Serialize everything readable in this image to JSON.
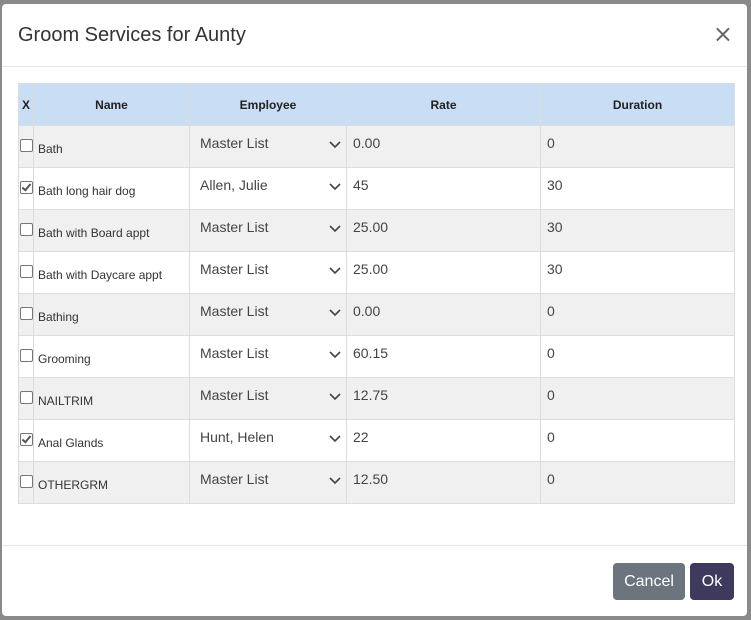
{
  "dialog": {
    "title": "Groom Services for Aunty",
    "close_glyph": "×"
  },
  "table": {
    "headers": {
      "x": "X",
      "name": "Name",
      "employee": "Employee",
      "rate": "Rate",
      "duration": "Duration"
    },
    "rows": [
      {
        "checked": false,
        "name": "Bath",
        "employee": "Master List",
        "rate": "0.00",
        "duration": "0"
      },
      {
        "checked": true,
        "name": "Bath long hair dog",
        "employee": "Allen, Julie",
        "rate": "45",
        "duration": "30"
      },
      {
        "checked": false,
        "name": "Bath with Board appt",
        "employee": "Master List",
        "rate": "25.00",
        "duration": "30"
      },
      {
        "checked": false,
        "name": "Bath with Daycare appt",
        "employee": "Master List",
        "rate": "25.00",
        "duration": "30"
      },
      {
        "checked": false,
        "name": "Bathing",
        "employee": "Master List",
        "rate": "0.00",
        "duration": "0"
      },
      {
        "checked": false,
        "name": "Grooming",
        "employee": "Master List",
        "rate": "60.15",
        "duration": "0"
      },
      {
        "checked": false,
        "name": "NAILTRIM",
        "employee": "Master List",
        "rate": "12.75",
        "duration": "0"
      },
      {
        "checked": true,
        "name": "Anal Glands",
        "employee": "Hunt, Helen",
        "rate": "22",
        "duration": "0"
      },
      {
        "checked": false,
        "name": "OTHERGRM",
        "employee": "Master List",
        "rate": "12.50",
        "duration": "0"
      }
    ]
  },
  "footer": {
    "cancel_label": "Cancel",
    "ok_label": "Ok"
  },
  "colors": {
    "header_bg": "#c9ddf5",
    "cancel_bg": "#6c757d",
    "ok_bg": "#3e3a5e"
  },
  "icons": {
    "dropdown": "chevron-down-icon",
    "close": "close-icon",
    "checkbox": "checkbox-icon"
  }
}
